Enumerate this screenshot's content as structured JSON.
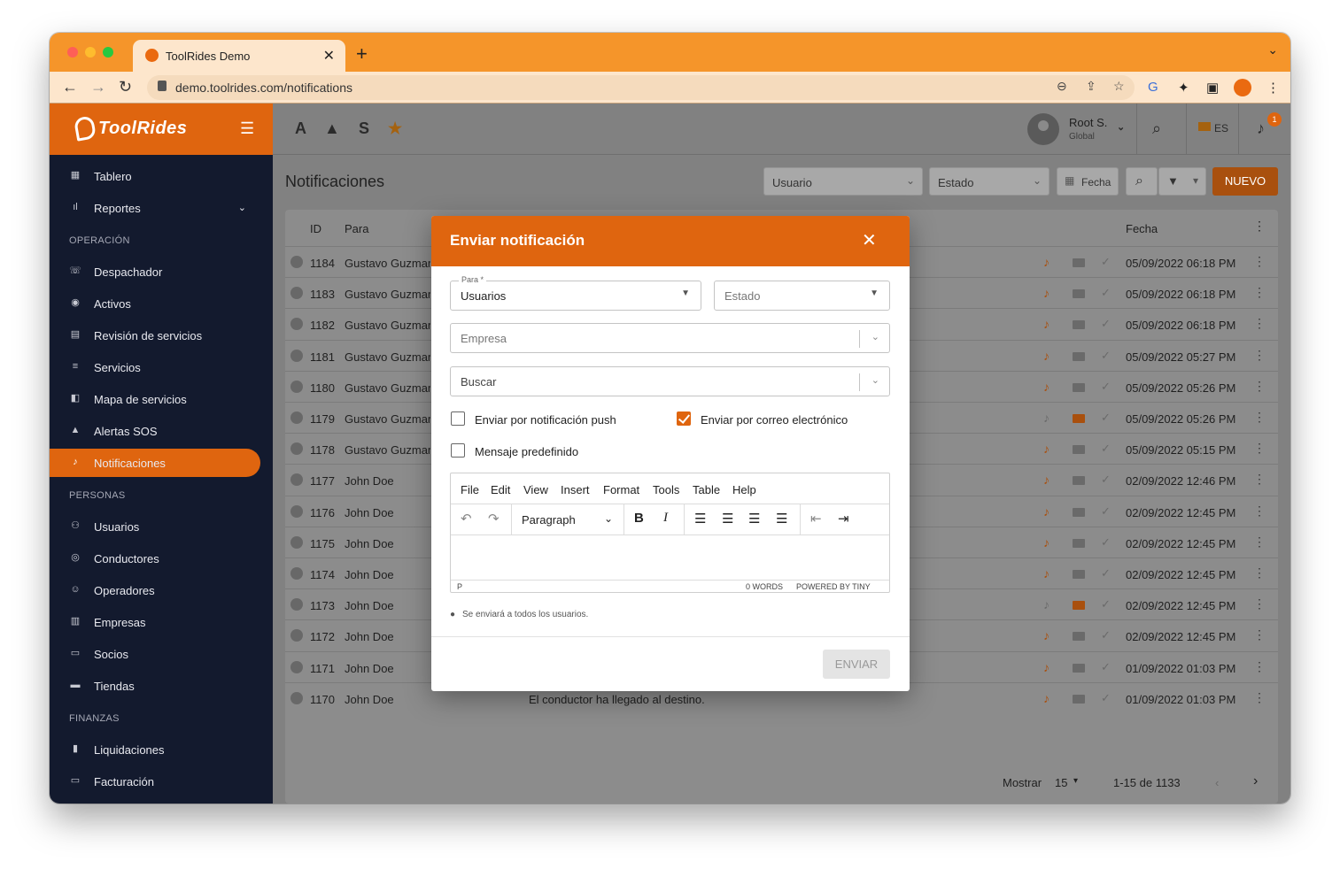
{
  "browser": {
    "tab_title": "ToolRides Demo",
    "url": "demo.toolrides.com/notifications"
  },
  "sidebar": {
    "brand": "ToolRides",
    "items": [
      {
        "label": "Tablero",
        "icon": "dashboard-icon"
      },
      {
        "label": "Reportes",
        "icon": "chart-icon",
        "has_submenu": true
      },
      {
        "section": "OPERACIÓN"
      },
      {
        "label": "Despachador",
        "icon": "phone-icon"
      },
      {
        "label": "Activos",
        "icon": "active-icon"
      },
      {
        "label": "Revisión de servicios",
        "icon": "review-icon"
      },
      {
        "label": "Servicios",
        "icon": "list-icon"
      },
      {
        "label": "Mapa de servicios",
        "icon": "map-icon"
      },
      {
        "label": "Alertas SOS",
        "icon": "warning-icon"
      },
      {
        "label": "Notificaciones",
        "icon": "bell-icon",
        "active": true
      },
      {
        "section": "PERSONAS"
      },
      {
        "label": "Usuarios",
        "icon": "users-icon"
      },
      {
        "label": "Conductores",
        "icon": "driver-icon"
      },
      {
        "label": "Operadores",
        "icon": "operator-icon"
      },
      {
        "label": "Empresas",
        "icon": "building-icon"
      },
      {
        "label": "Socios",
        "icon": "briefcase-icon"
      },
      {
        "label": "Tiendas",
        "icon": "store-icon"
      },
      {
        "section": "FINANZAS"
      },
      {
        "label": "Liquidaciones",
        "icon": "clipboard-icon"
      },
      {
        "label": "Facturación",
        "icon": "card-icon"
      }
    ]
  },
  "topbar": {
    "icons": [
      "A",
      "S"
    ],
    "user_name": "Root S.",
    "user_role": "Global",
    "language": "ES",
    "notification_count": "1"
  },
  "page": {
    "title": "Notificaciones",
    "filters": {
      "usuario": "Usuario",
      "estado": "Estado",
      "fecha": "Fecha"
    },
    "new_button": "NUEVO"
  },
  "table": {
    "headers": {
      "id": "ID",
      "para": "Para",
      "fecha": "Fecha"
    },
    "rows": [
      {
        "id": "1184",
        "para": "Gustavo Guzman",
        "msg": "",
        "fecha": "05/09/2022 06:18 PM",
        "push": true,
        "email": false
      },
      {
        "id": "1183",
        "para": "Gustavo Guzman",
        "msg": "",
        "fecha": "05/09/2022 06:18 PM",
        "push": true,
        "email": false
      },
      {
        "id": "1182",
        "para": "Gustavo Guzman",
        "msg": "",
        "fecha": "05/09/2022 06:18 PM",
        "push": true,
        "email": false
      },
      {
        "id": "1181",
        "para": "Gustavo Guzman",
        "msg": "",
        "fecha": "05/09/2022 05:27 PM",
        "push": true,
        "email": false
      },
      {
        "id": "1180",
        "para": "Gustavo Guzman",
        "msg": "",
        "fecha": "05/09/2022 05:26 PM",
        "push": true,
        "email": false
      },
      {
        "id": "1179",
        "para": "Gustavo Guzman",
        "msg": "",
        "fecha": "05/09/2022 05:26 PM",
        "push": false,
        "email": true
      },
      {
        "id": "1178",
        "para": "Gustavo Guzman",
        "msg": "",
        "fecha": "05/09/2022 05:15 PM",
        "push": true,
        "email": false
      },
      {
        "id": "1177",
        "para": "John Doe",
        "msg": "",
        "fecha": "02/09/2022 12:46 PM",
        "push": true,
        "email": false
      },
      {
        "id": "1176",
        "para": "John Doe",
        "msg": "",
        "fecha": "02/09/2022 12:45 PM",
        "push": true,
        "email": false
      },
      {
        "id": "1175",
        "para": "John Doe",
        "msg": "",
        "fecha": "02/09/2022 12:45 PM",
        "push": true,
        "email": false
      },
      {
        "id": "1174",
        "para": "John Doe",
        "msg": "",
        "fecha": "02/09/2022 12:45 PM",
        "push": true,
        "email": false
      },
      {
        "id": "1173",
        "para": "John Doe",
        "msg": "",
        "fecha": "02/09/2022 12:45 PM",
        "push": false,
        "email": true
      },
      {
        "id": "1172",
        "para": "John Doe",
        "msg": "",
        "fecha": "02/09/2022 12:45 PM",
        "push": true,
        "email": false
      },
      {
        "id": "1171",
        "para": "John Doe",
        "msg": "",
        "fecha": "01/09/2022 01:03 PM",
        "push": true,
        "email": false
      },
      {
        "id": "1170",
        "para": "John Doe",
        "msg": "El conductor ha llegado al destino.",
        "fecha": "01/09/2022 01:03 PM",
        "push": true,
        "email": false
      }
    ],
    "pager": {
      "show_label": "Mostrar",
      "per_page": "15",
      "range": "1-15 de 1133"
    }
  },
  "modal": {
    "title": "Enviar notificación",
    "para_label": "Para *",
    "para_value": "Usuarios",
    "estado_placeholder": "Estado",
    "empresa_placeholder": "Empresa",
    "buscar_placeholder": "Buscar",
    "push_label": "Enviar por notificación push",
    "push_checked": false,
    "email_label": "Enviar por correo electrónico",
    "email_checked": true,
    "predef_label": "Mensaje predefinido",
    "predef_checked": false,
    "editor": {
      "menu": [
        "File",
        "Edit",
        "View",
        "Insert",
        "Format",
        "Tools",
        "Table",
        "Help"
      ],
      "block_format": "Paragraph",
      "status_path": "P",
      "word_count": "0 WORDS",
      "powered": "POWERED BY TINY"
    },
    "hint": "Se enviará a todos los usuarios.",
    "send_button": "ENVIAR"
  },
  "colors": {
    "accent": "#df650f",
    "sidebar": "#131a2e",
    "browser": "#f5952a"
  }
}
